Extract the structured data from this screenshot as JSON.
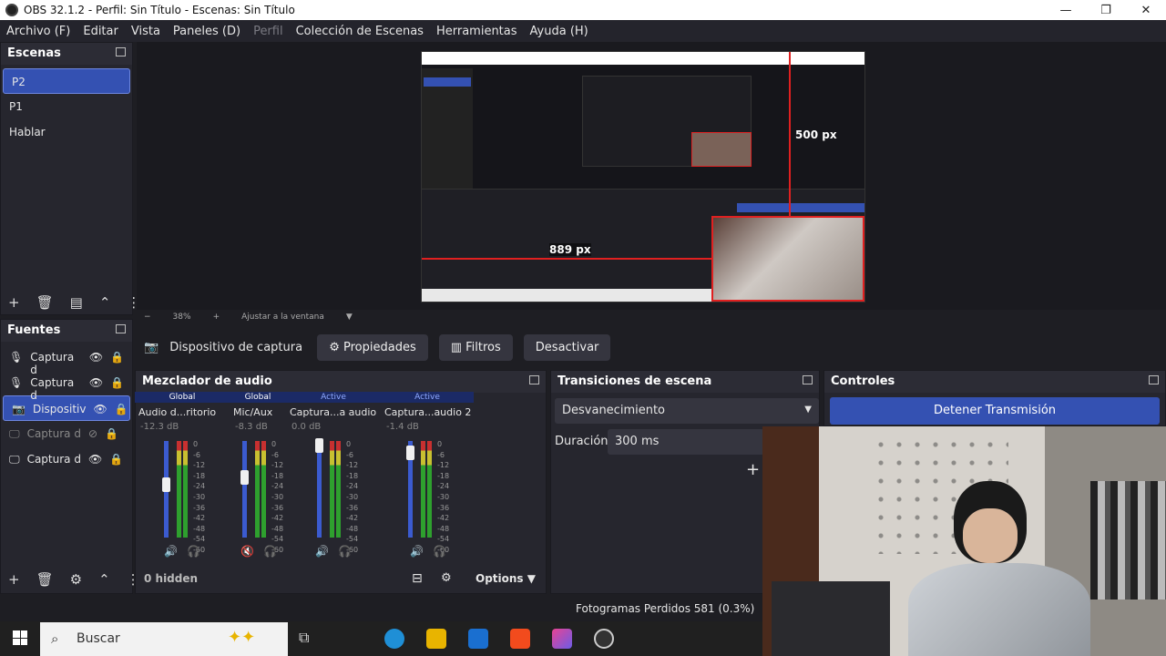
{
  "window": {
    "title": "OBS 32.1.2 - Perfil: Sin Título - Escenas: Sin Título"
  },
  "menu": [
    "Archivo (F)",
    "Editar",
    "Vista",
    "Paneles (D)",
    "Perfil",
    "Colección de Escenas",
    "Herramientas",
    "Ayuda (H)"
  ],
  "scenes": {
    "title": "Escenas",
    "items": [
      "P2",
      "P1",
      "Hablar"
    ]
  },
  "sources": {
    "title": "Fuentes",
    "items": [
      "Captura d",
      "Captura d",
      "Dispositiv",
      "Captura d",
      "Captura d"
    ]
  },
  "preview": {
    "zoom": "38%",
    "fit_label": "Ajustar a la ventana",
    "label_500": "500 px",
    "label_889": "889 px"
  },
  "context_bar": {
    "source_name": "Dispositivo de captura de v",
    "properties": "Propiedades",
    "filters": "Filtros",
    "deactivate": "Desactivar"
  },
  "mixer": {
    "title": "Mezclador de audio",
    "strips": [
      {
        "header": "Global",
        "name": "Audio d...ritorio",
        "db": "-12.3 dB",
        "level": 0.55
      },
      {
        "header": "Global",
        "name": "Mic/Aux",
        "db": "-8.3 dB",
        "level": 0.62
      },
      {
        "header": "Active",
        "name": "Captura...a audio",
        "db": "0.0 dB",
        "level": 0.95
      },
      {
        "header": "Active",
        "name": "Captura...audio 2",
        "db": "-1.4 dB",
        "level": 0.88
      }
    ],
    "scale": [
      "0",
      "-6",
      "-12",
      "-18",
      "-24",
      "-30",
      "-36",
      "-42",
      "-48",
      "-54",
      "-60"
    ],
    "hidden_label": "0 hidden",
    "options_label": "Options"
  },
  "transitions": {
    "title": "Transiciones de escena",
    "selected": "Desvanecimiento",
    "duration_label": "Duración",
    "duration_value": "300 ms"
  },
  "controls": {
    "title": "Controles",
    "stop_stream": "Detener Transmisión"
  },
  "status": {
    "dropped_frames": "Fotogramas Perdidos 581 (0.3%)"
  },
  "taskbar": {
    "search_placeholder": "Buscar"
  },
  "colors": {
    "accent": "#3451b2",
    "panel": "#26262e",
    "bg": "#1e1e23"
  }
}
